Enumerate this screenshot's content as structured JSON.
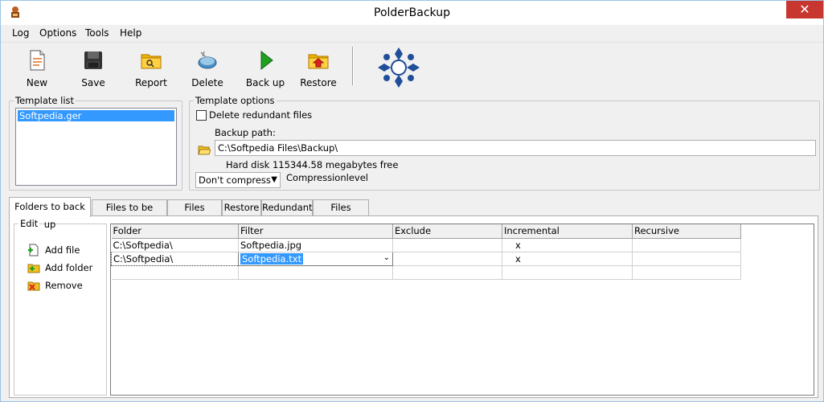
{
  "window": {
    "title": "PolderBackup",
    "close_glyph": "✕"
  },
  "menu": [
    "Log",
    "Options",
    "Tools",
    "Help"
  ],
  "toolbar": {
    "buttons": [
      {
        "label": "New",
        "icon": "new-document-icon"
      },
      {
        "label": "Save",
        "icon": "floppy-disk-icon"
      },
      {
        "label": "Report",
        "icon": "folder-report-icon"
      },
      {
        "label": "Delete",
        "icon": "delete-disk-icon"
      },
      {
        "label": "Back up",
        "icon": "play-arrow-icon"
      },
      {
        "label": "Restore",
        "icon": "folder-restore-icon"
      }
    ],
    "logo": "polder-logo"
  },
  "template_list": {
    "label": "Template list",
    "items": [
      "Softpedia.ger"
    ],
    "selected": "Softpedia.ger"
  },
  "template_options": {
    "label": "Template options",
    "delete_redundant_label": "Delete redundant files",
    "delete_redundant_checked": false,
    "backup_path_label": "Backup path:",
    "backup_path_value": "C:\\Softpedia Files\\Backup\\",
    "hard_disk_text": "Hard disk 115344.58 megabytes free",
    "compression_value": "Don't compress",
    "compression_label": "Compressionlevel"
  },
  "tabs": [
    "Folders to back up",
    "Files to be copied",
    "Files copied",
    "Restore",
    "Redundant",
    "Files deleted"
  ],
  "active_tab": "Folders to back up",
  "edit": {
    "label": "Edit",
    "items": [
      {
        "label": "Add file",
        "icon": "add-file-icon"
      },
      {
        "label": "Add folder",
        "icon": "add-folder-icon"
      },
      {
        "label": "Remove",
        "icon": "remove-icon"
      }
    ]
  },
  "grid": {
    "columns": [
      "Folder",
      "Filter",
      "Exclude",
      "Incremental",
      "Recursive"
    ],
    "rows": [
      {
        "folder": "C:\\Softpedia\\",
        "filter": "Softpedia.jpg",
        "exclude": "",
        "incremental": "x",
        "recursive": ""
      },
      {
        "folder": "C:\\Softpedia\\",
        "filter": "Softpedia.txt",
        "exclude": "",
        "incremental": "x",
        "recursive": ""
      }
    ],
    "editing_row": 1
  }
}
